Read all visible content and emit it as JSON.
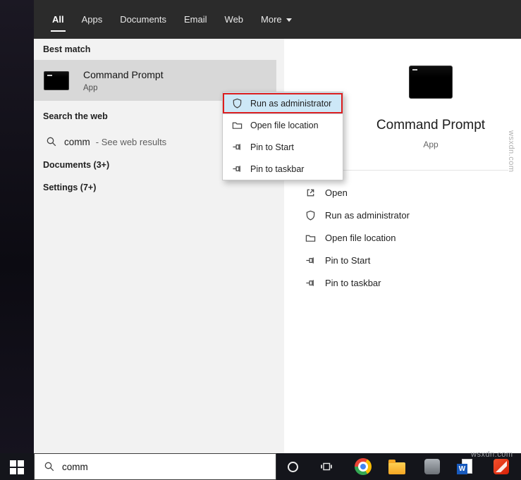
{
  "header": {
    "tabs": [
      {
        "label": "All",
        "active": true
      },
      {
        "label": "Apps",
        "active": false
      },
      {
        "label": "Documents",
        "active": false
      },
      {
        "label": "Email",
        "active": false
      },
      {
        "label": "Web",
        "active": false
      },
      {
        "label": "More",
        "active": false,
        "has_dropdown": true
      }
    ]
  },
  "results": {
    "best_match_header": "Best match",
    "best_match": {
      "title": "Command Prompt",
      "subtitle": "App"
    },
    "search_web_header": "Search the web",
    "web_suggestion": {
      "query": "comm",
      "hint": "- See web results"
    },
    "documents_header": "Documents (3+)",
    "settings_header": "Settings (7+)"
  },
  "context_menu": {
    "items": [
      {
        "label": "Run as administrator",
        "highlighted": true
      },
      {
        "label": "Open file location",
        "highlighted": false
      },
      {
        "label": "Pin to Start",
        "highlighted": false
      },
      {
        "label": "Pin to taskbar",
        "highlighted": false
      }
    ]
  },
  "preview": {
    "title": "Command Prompt",
    "subtitle": "App",
    "actions": [
      {
        "label": "Open"
      },
      {
        "label": "Run as administrator"
      },
      {
        "label": "Open file location"
      },
      {
        "label": "Pin to Start"
      },
      {
        "label": "Pin to taskbar"
      }
    ]
  },
  "taskbar": {
    "search_value": "comm",
    "word_glyph": "W"
  },
  "watermark": {
    "text": "wsxdn.com"
  },
  "colors": {
    "annotation_red": "#dd1d1d",
    "header_bg": "#2b2b2b",
    "panel_bg": "#f2f2f2",
    "highlight_bg": "#cde8f7",
    "taskbar_bg": "#14151b"
  }
}
